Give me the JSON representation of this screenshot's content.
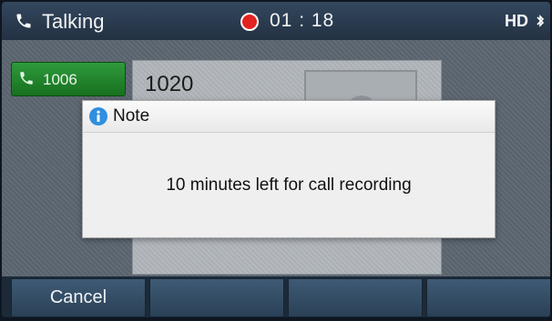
{
  "status_bar": {
    "status": "Talking",
    "timer": "01 : 18",
    "hd_badge": "HD",
    "icons": [
      "phone-icon",
      "record-icon",
      "bluetooth-icon"
    ],
    "record_color": "#e32222"
  },
  "line_key": {
    "label": "1006",
    "icon": "phone-icon",
    "color": "#1f8a2c"
  },
  "call": {
    "number": "1020"
  },
  "dialog": {
    "title": "Note",
    "message": "10 minutes left for call recording",
    "icon": "info-icon"
  },
  "softkeys": [
    {
      "label": "Cancel"
    },
    {
      "label": ""
    },
    {
      "label": ""
    },
    {
      "label": ""
    }
  ]
}
